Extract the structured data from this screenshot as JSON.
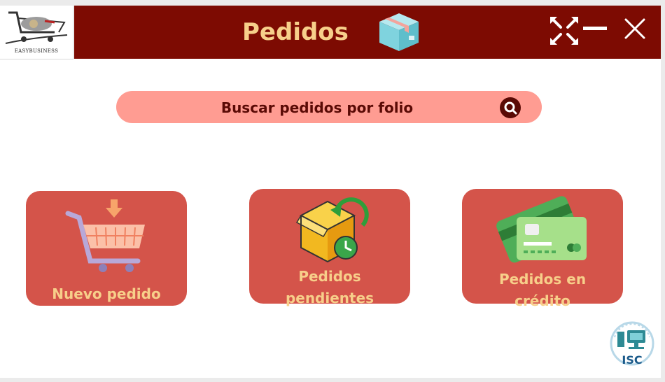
{
  "brand": {
    "logo_text": "EASYBUSINESS"
  },
  "header": {
    "title": "Pedidos"
  },
  "window_controls": {
    "expand": "expand-icon",
    "minimize": "minimize-icon",
    "close": "close-icon"
  },
  "search": {
    "placeholder": "Buscar pedidos por folio",
    "value": ""
  },
  "cards": [
    {
      "label": "Nuevo pedido",
      "icon": "shopping-cart-icon"
    },
    {
      "label_line1": "Pedidos",
      "label_line2": "pendientes",
      "icon": "pending-box-icon"
    },
    {
      "label_line1": "Pedidos en",
      "label_line2": "crédito",
      "icon": "credit-card-icon"
    }
  ],
  "corner_logo": {
    "text": "ISC"
  },
  "colors": {
    "header_bg": "#7d0b02",
    "accent_text": "#f7cf8a",
    "card_bg": "#d4544a",
    "search_bg": "#ff9c92"
  }
}
